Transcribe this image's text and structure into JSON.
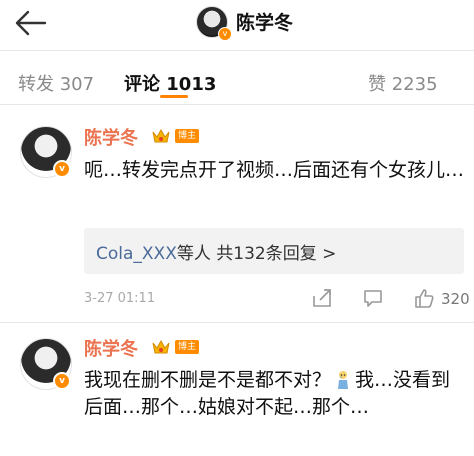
{
  "header": {
    "title": "陈学冬",
    "badge_icon": "v-verified-icon"
  },
  "tabs": [
    {
      "label": "转发 307"
    },
    {
      "label": "评论 1013"
    },
    {
      "label": "赞 2235"
    }
  ],
  "comments": [
    {
      "name": "陈学冬",
      "author_tag": "博主",
      "text": "呃…转发完点开了视频…后面还有个女孩儿…",
      "replies": {
        "link": "Cola_XXX",
        "rest": "等人 共132条回复 >"
      },
      "time": "3-27 01:11",
      "likes": "320"
    },
    {
      "name": "陈学冬",
      "author_tag": "博主",
      "text_before_emoji": "我现在删不删是不是都不对？",
      "emoji_icon": "crying-figure-icon",
      "text_after_emoji": "我…没看到后面…那个…姑娘对不起…那个…"
    }
  ],
  "colors": {
    "accent": "#ff8200",
    "name": "#eb7350",
    "link": "#4a6a9a"
  }
}
